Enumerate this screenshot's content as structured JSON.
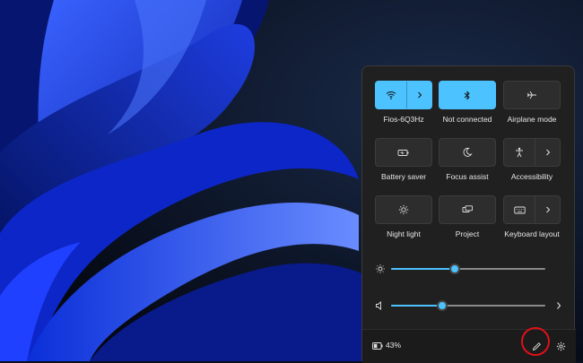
{
  "quick_settings": {
    "tiles": [
      {
        "label": "Fios-6Q3Hz",
        "icon": "wifi-icon",
        "state": "on",
        "has_arrow": true
      },
      {
        "label": "Not connected",
        "icon": "bluetooth-icon",
        "state": "on",
        "has_arrow": false
      },
      {
        "label": "Airplane mode",
        "icon": "airplane-icon",
        "state": "off",
        "has_arrow": false
      },
      {
        "label": "Battery saver",
        "icon": "battery-saver-icon",
        "state": "off",
        "has_arrow": false
      },
      {
        "label": "Focus assist",
        "icon": "moon-icon",
        "state": "off",
        "has_arrow": false
      },
      {
        "label": "Accessibility",
        "icon": "accessibility-icon",
        "state": "off",
        "has_arrow": true
      },
      {
        "label": "Night light",
        "icon": "sun-icon",
        "state": "off",
        "has_arrow": false
      },
      {
        "label": "Project",
        "icon": "project-icon",
        "state": "off",
        "has_arrow": false
      },
      {
        "label": "Keyboard layout",
        "icon": "keyboard-icon",
        "state": "off",
        "has_arrow": true
      }
    ],
    "brightness": {
      "icon": "brightness-icon",
      "level_percent": 41
    },
    "volume": {
      "icon": "speaker-icon",
      "level_percent": 33
    },
    "battery": {
      "icon": "battery-icon",
      "percent_text": "43%"
    },
    "footer_icons": [
      "edit-pencil-icon",
      "settings-gear-icon"
    ]
  },
  "colors": {
    "accent": "#4cc2ff",
    "panel": "#202020",
    "tile_off": "#2d2d2d",
    "highlight": "#e0101a"
  }
}
